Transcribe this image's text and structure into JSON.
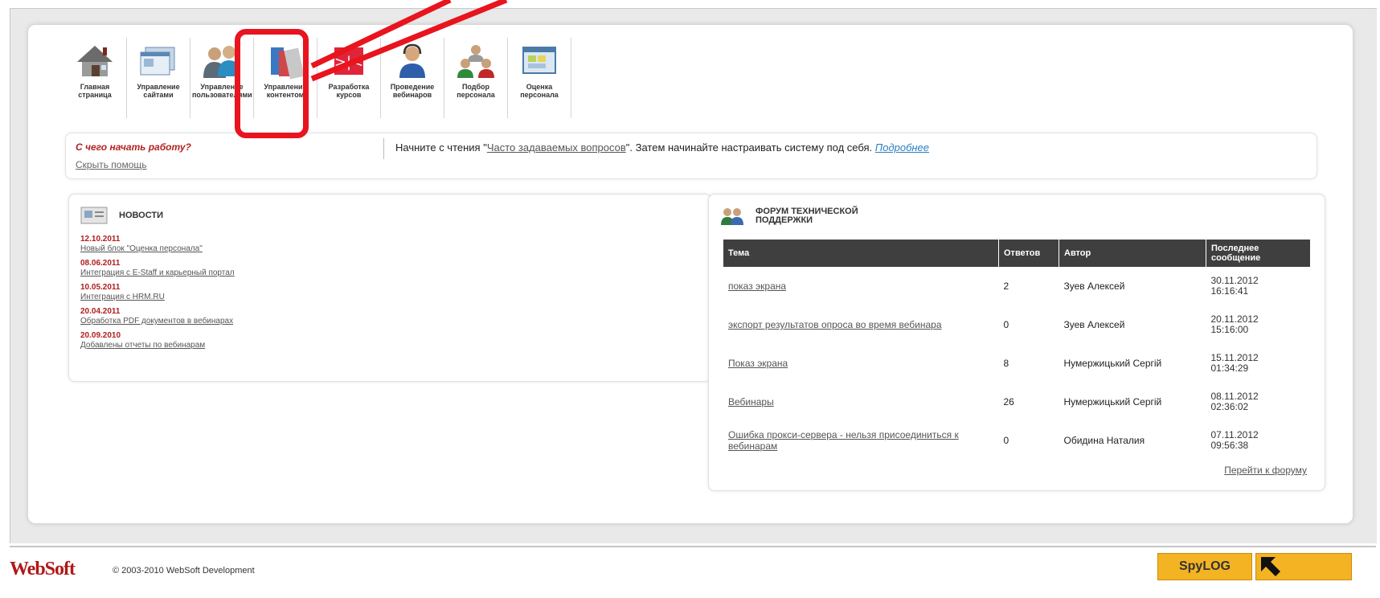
{
  "toolbar": {
    "items": [
      {
        "label": "Главная страница",
        "icon": "house-icon"
      },
      {
        "label": "Управление сайтами",
        "icon": "websites-icon"
      },
      {
        "label": "Управление пользователями",
        "icon": "users-icon"
      },
      {
        "label": "Управление контентом",
        "icon": "content-icon"
      },
      {
        "label": "Разработка курсов",
        "icon": "course-dev-icon"
      },
      {
        "label": "Проведение вебинаров",
        "icon": "webinar-icon"
      },
      {
        "label": "Подбор персонала",
        "icon": "recruit-icon"
      },
      {
        "label": "Оценка персонала",
        "icon": "evaluation-icon"
      }
    ]
  },
  "help": {
    "question": "С чего начать работу?",
    "hide": "Скрыть помощь",
    "text_before": "Начните с чтения \"",
    "faq_link": "Часто задаваемых вопросов",
    "text_after": "\". Затем начинайте настраивать систему под себя.",
    "more_link": "Подробнее"
  },
  "news": {
    "title": "НОВОСТИ",
    "items": [
      {
        "date": "12.10.2011",
        "text": "Новый блок \"Оценка персонала\""
      },
      {
        "date": "08.06.2011",
        "text": "Интеграция с E-Staff и карьерный портал"
      },
      {
        "date": "10.05.2011",
        "text": "Интеграция с HRM.RU"
      },
      {
        "date": "20.04.2011",
        "text": "Обработка PDF документов в вебинарах"
      },
      {
        "date": "20.09.2010",
        "text": "Добавлены отчеты по вебинарам"
      }
    ]
  },
  "forum": {
    "title_line1": "ФОРУМ ТЕХНИЧЕСКОЙ",
    "title_line2": "ПОДДЕРЖКИ",
    "headers": {
      "topic": "Тема",
      "answers": "Ответов",
      "author": "Автор",
      "last_line1": "Последнее",
      "last_line2": "сообщение"
    },
    "rows": [
      {
        "topic": "показ экрана",
        "answers": "2",
        "author": "Зуев Алексей",
        "date": "30.11.2012",
        "time": "16:16:41"
      },
      {
        "topic": "экспорт результатов опроса во время вебинара",
        "answers": "0",
        "author": "Зуев Алексей",
        "date": "20.11.2012",
        "time": "15:16:00"
      },
      {
        "topic": "Показ экрана",
        "answers": "8",
        "author": "Нумержицький Сергій",
        "date": "15.11.2012",
        "time": "01:34:29"
      },
      {
        "topic": "Вебинары",
        "answers": "26",
        "author": "Нумержицький Сергій",
        "date": "08.11.2012",
        "time": "02:36:02"
      },
      {
        "topic": "Ошибка прокси-сервера - нельзя присоединиться к вебинарам",
        "answers": "0",
        "author": "Обидина Наталия",
        "date": "07.11.2012",
        "time": "09:56:38"
      }
    ],
    "go_link": "Перейти к форуму"
  },
  "footer": {
    "logo": "WebSoft",
    "copyright": "© 2003-2010 WebSoft Development",
    "counter": "SpyLOG"
  },
  "colors": {
    "accent_red": "#b01e1e",
    "highlight": "#e8141e",
    "header_dark": "#3f3f3f",
    "counter_yellow": "#f4b323"
  }
}
